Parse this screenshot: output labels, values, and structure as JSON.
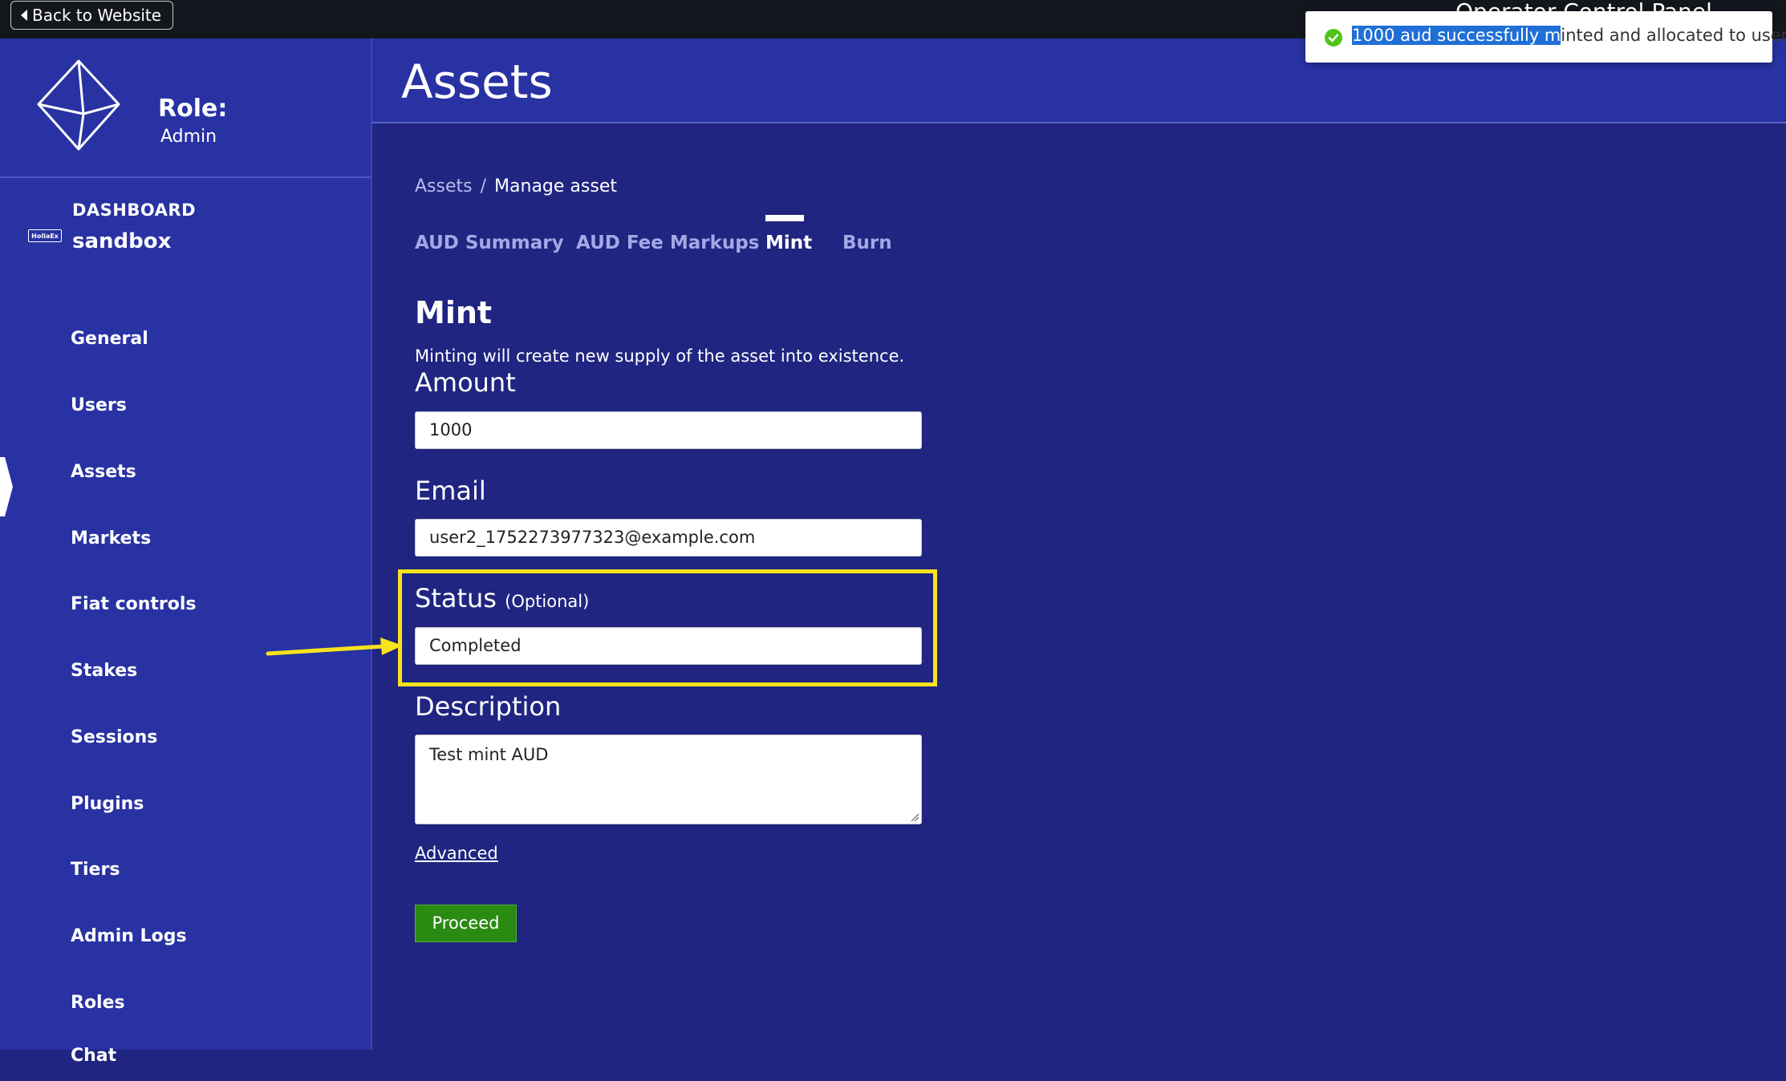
{
  "topbar": {
    "back_label": "Back to Website",
    "cut_text": "Operator Control Panel"
  },
  "sidebar": {
    "role_title": "Role:",
    "role_value": "Admin",
    "dashboard_title": "DASHBOARD",
    "dashboard_sub": "sandbox",
    "dashboard_badge": "HollaEx",
    "items": [
      {
        "label": "General"
      },
      {
        "label": "Users"
      },
      {
        "label": "Assets"
      },
      {
        "label": "Markets"
      },
      {
        "label": "Fiat controls"
      },
      {
        "label": "Stakes"
      },
      {
        "label": "Sessions"
      },
      {
        "label": "Plugins"
      },
      {
        "label": "Tiers"
      },
      {
        "label": "Admin Logs"
      },
      {
        "label": "Roles"
      },
      {
        "label": "Chat"
      }
    ]
  },
  "header": {
    "title": "Assets"
  },
  "breadcrumb": {
    "parent": "Assets",
    "separator": "/",
    "current": "Manage asset"
  },
  "tabs": [
    {
      "label": "AUD Summary"
    },
    {
      "label": "AUD Fee Markups"
    },
    {
      "label": "Mint"
    },
    {
      "label": "Burn"
    }
  ],
  "form": {
    "title": "Mint",
    "description": "Minting will create new supply of the asset into existence.",
    "amount_label": "Amount",
    "amount_value": "1000",
    "email_label": "Email",
    "email_value": "user2_1752273977323@example.com",
    "status_label": "Status",
    "status_optional": "(Optional)",
    "status_value": "Completed",
    "description_label": "Description",
    "description_value": "Test mint AUD",
    "advanced_label": "Advanced",
    "proceed_label": "Proceed"
  },
  "toast": {
    "text_selected": "1000 aud successfully m",
    "text_rest": "inted and allocated to user"
  },
  "colors": {
    "background": "#1f2580",
    "sidebar": "#2832a3",
    "highlight": "#f7e31c",
    "proceed": "#2a8b12",
    "success": "#52c41a"
  }
}
